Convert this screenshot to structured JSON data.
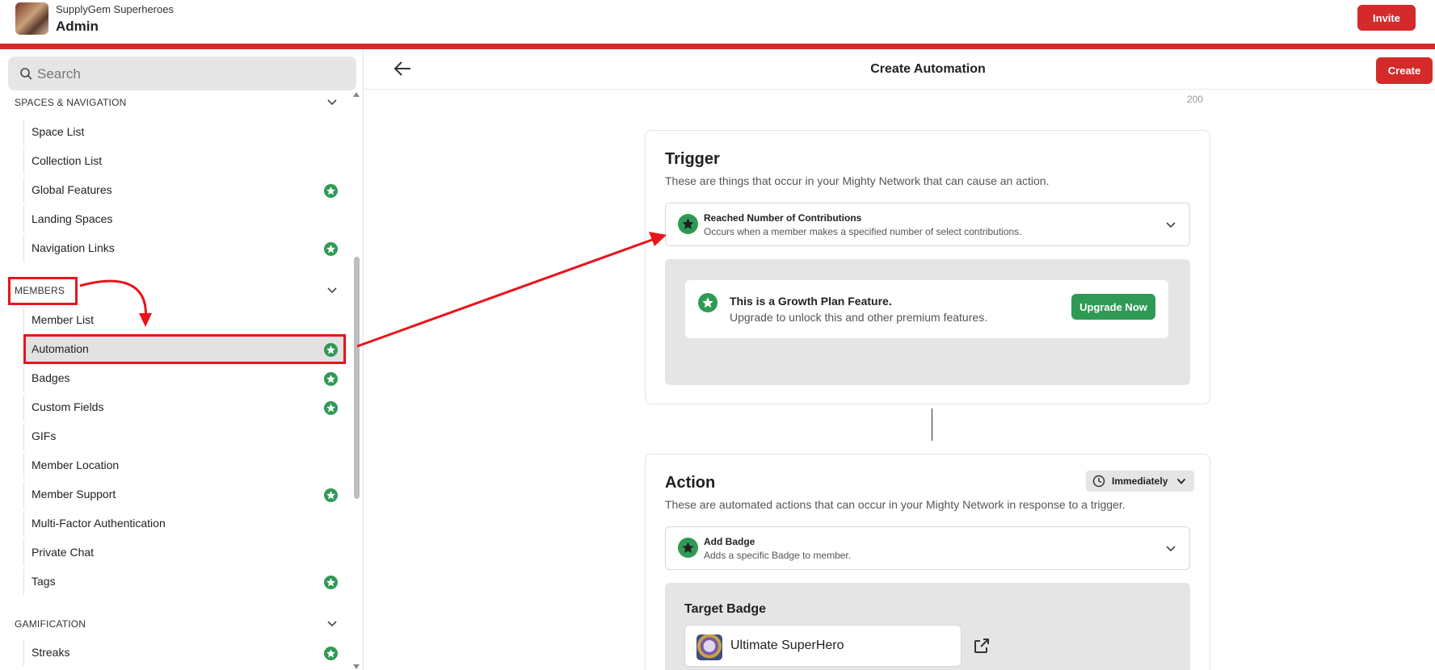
{
  "header": {
    "org_name": "SupplyGem Superheroes",
    "org_subtitle": "Admin",
    "invite_label": "Invite",
    "accent_color": "#d42a2a"
  },
  "sidebar": {
    "search_placeholder": "Search",
    "sections": [
      {
        "title": "SPACES & NAVIGATION",
        "items": [
          {
            "label": "Space List",
            "growth": false
          },
          {
            "label": "Collection List",
            "growth": false
          },
          {
            "label": "Global Features",
            "growth": true
          },
          {
            "label": "Landing Spaces",
            "growth": false
          },
          {
            "label": "Navigation Links",
            "growth": true
          }
        ]
      },
      {
        "title": "MEMBERS",
        "items": [
          {
            "label": "Member List",
            "growth": false
          },
          {
            "label": "Automation",
            "growth": true,
            "active": true
          },
          {
            "label": "Badges",
            "growth": true
          },
          {
            "label": "Custom Fields",
            "growth": true
          },
          {
            "label": "GIFs",
            "growth": false
          },
          {
            "label": "Member Location",
            "growth": false
          },
          {
            "label": "Member Support",
            "growth": true
          },
          {
            "label": "Multi-Factor Authentication",
            "growth": false
          },
          {
            "label": "Private Chat",
            "growth": false
          },
          {
            "label": "Tags",
            "growth": true
          }
        ]
      },
      {
        "title": "GAMIFICATION",
        "items": [
          {
            "label": "Streaks",
            "growth": true
          }
        ]
      }
    ],
    "growth_icon": "star-badge-icon",
    "growth_color": "#2e9a55"
  },
  "main": {
    "title": "Create Automation",
    "create_label": "Create",
    "counter": "200",
    "trigger": {
      "title": "Trigger",
      "description": "These are things that occur in your Mighty Network that can cause an action.",
      "selected_title": "Reached Number of Contributions",
      "selected_subtitle": "Occurs when a member makes a specified number of select contributions.",
      "upgrade_title": "This is a Growth Plan Feature.",
      "upgrade_subtitle": "Upgrade to unlock this and other premium features.",
      "upgrade_button": "Upgrade Now"
    },
    "action": {
      "title": "Action",
      "timing": "Immediately",
      "description": "These are automated actions that can occur in your Mighty Network in response to a trigger.",
      "selected_title": "Add Badge",
      "selected_subtitle": "Adds a specific Badge to member.",
      "target_title": "Target Badge",
      "target_value": "Ultimate SuperHero"
    }
  },
  "annotation_color": "#e8141b"
}
